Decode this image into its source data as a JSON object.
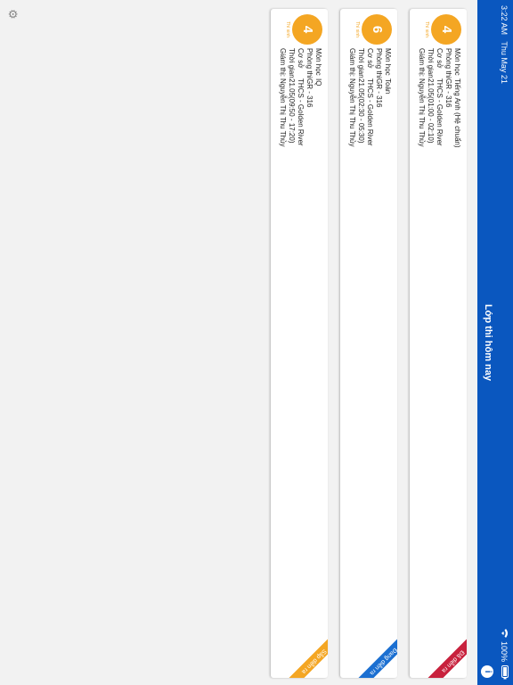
{
  "status_bar": {
    "time": "3:22 AM",
    "date": "Thu May 21",
    "wifi": "wifi-icon",
    "battery_percent": "100%"
  },
  "app_bar": {
    "title": "Lớp thi hôm nay",
    "info_icon": "info-icon"
  },
  "cards": [
    {
      "count": "4",
      "count_label": "Thí sinh",
      "rows": [
        {
          "label": "Môn học",
          "value": "Tiếng Anh (Hệ chuẩn)"
        },
        {
          "label": "Phòng thi",
          "value": "GR - 316"
        },
        {
          "label": "Cơ sở",
          "value": "THCS - Golden River"
        },
        {
          "label": "Thời gian",
          "value": "21.05(01:00 - 02:10)"
        },
        {
          "label": "Giám thị:",
          "value": "Nguyễn Thị Thu Thủy"
        }
      ],
      "ribbon": "Đã diễn ra",
      "ribbon_color": "#c8213d"
    },
    {
      "count": "6",
      "count_label": "Thí sinh",
      "rows": [
        {
          "label": "Môn học",
          "value": "Toán"
        },
        {
          "label": "Phòng thi",
          "value": "GR - 316"
        },
        {
          "label": "Cơ sở",
          "value": "THCS - Golden River"
        },
        {
          "label": "Thời gian",
          "value": "21.05(02:30 - 05:30)"
        },
        {
          "label": "Giám thị:",
          "value": "Nguyễn Thị Thu Thủy"
        }
      ],
      "ribbon": "Đang diễn ra",
      "ribbon_color": "#1b6fd1"
    },
    {
      "count": "4",
      "count_label": "Thí sinh",
      "rows": [
        {
          "label": "Môn học",
          "value": "IQ"
        },
        {
          "label": "Phòng thi",
          "value": "GR - 316"
        },
        {
          "label": "Cơ sở",
          "value": "THCS - Golden River"
        },
        {
          "label": "Thời gian",
          "value": "21.05(09:50 - 17:20)"
        },
        {
          "label": "Giám thị:",
          "value": "Nguyễn Thị Thu Thủy"
        }
      ],
      "ribbon": "Sắp diễn ra",
      "ribbon_color": "#f4a623"
    }
  ],
  "settings_icon": "gear-icon"
}
